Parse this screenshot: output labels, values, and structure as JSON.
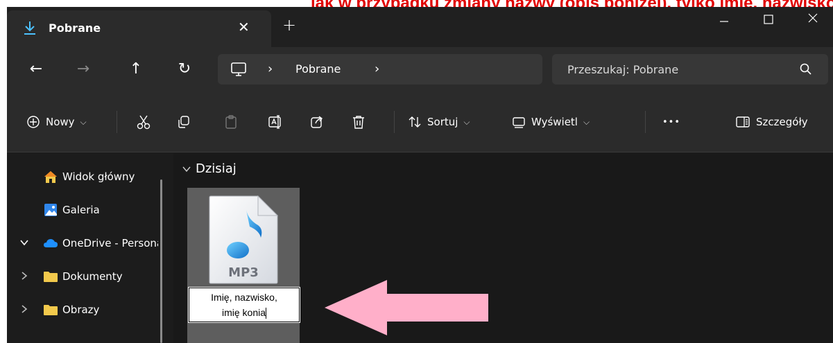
{
  "banner": {
    "text": "jak w przypadku zmiany nazwy (opis poniżej), tylko imię, nazwisko, imię konia"
  },
  "tab": {
    "title": "Pobrane",
    "close": "✕",
    "new_tab": "+"
  },
  "window_controls": {
    "minimize": "—",
    "maximize": "☐",
    "close": "✕"
  },
  "nav": {
    "back": "←",
    "forward": "→",
    "up": "↑",
    "refresh": "↻"
  },
  "address": {
    "crumbs": [
      "Pobrane"
    ],
    "separator": "›"
  },
  "search": {
    "placeholder": "Przeszukaj: Pobrane"
  },
  "toolbar": {
    "new_label": "Nowy",
    "sort_label": "Sortuj",
    "view_label": "Wyświetl",
    "more_label": "•••",
    "details_label": "Szczegóły"
  },
  "sidebar": {
    "items": [
      {
        "label": "Widok główny",
        "icon": "home-icon"
      },
      {
        "label": "Galeria",
        "icon": "gallery-icon"
      },
      {
        "label": "OneDrive - Personal",
        "icon": "onedrive-icon",
        "expanded": true
      },
      {
        "label": "Dokumenty",
        "icon": "folder-icon"
      },
      {
        "label": "Obrazy",
        "icon": "folder-icon"
      }
    ]
  },
  "content": {
    "group_label": "Dzisiaj",
    "file": {
      "type_label": "MP3",
      "rename_line1": "Imię, nazwisko,",
      "rename_line2": "imię konia"
    }
  },
  "colors": {
    "accent": "#1ba1e2",
    "arrow": "#ffafc9",
    "banner": "#e00000",
    "folder": "#f2c94c"
  }
}
